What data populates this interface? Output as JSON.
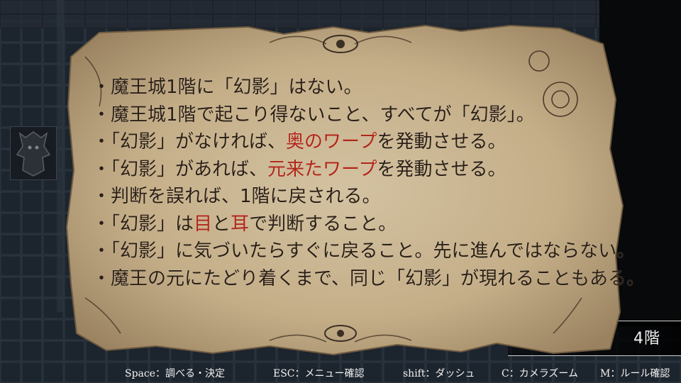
{
  "rules": [
    {
      "segments": [
        {
          "text": "・魔王城1階に「幻影」はない。",
          "hl": false
        }
      ]
    },
    {
      "segments": [
        {
          "text": "・魔王城1階で起こり得ないこと、すべてが「幻影」。",
          "hl": false
        }
      ]
    },
    {
      "segments": [
        {
          "text": "・「幻影」がなければ、",
          "hl": false
        },
        {
          "text": "奥のワープ",
          "hl": true
        },
        {
          "text": "を発動させる。",
          "hl": false
        }
      ]
    },
    {
      "segments": [
        {
          "text": "・「幻影」があれば、",
          "hl": false
        },
        {
          "text": "元来たワープ",
          "hl": true
        },
        {
          "text": "を発動させる。",
          "hl": false
        }
      ]
    },
    {
      "segments": [
        {
          "text": "・判断を誤れば、1階に戻される。",
          "hl": false
        }
      ]
    },
    {
      "segments": [
        {
          "text": "・「幻影」は",
          "hl": false
        },
        {
          "text": "目",
          "hl": true
        },
        {
          "text": "と",
          "hl": false
        },
        {
          "text": "耳",
          "hl": true
        },
        {
          "text": "で判断すること。",
          "hl": false
        }
      ]
    },
    {
      "segments": [
        {
          "text": "・「幻影」に気づいたらすぐに戻ること。先に進んではならない。",
          "hl": false
        }
      ]
    },
    {
      "segments": [
        {
          "text": "・魔王の元にたどり着くまで、同じ「幻影」が現れることもある。",
          "hl": false
        }
      ]
    }
  ],
  "location": {
    "label": "王城　 4階"
  },
  "controls": [
    {
      "label": "Space：調べる・決定"
    },
    {
      "label": "ESC：メニュー確認"
    },
    {
      "label": "shift：ダッシュ"
    },
    {
      "label": "C：カメラズーム"
    },
    {
      "label": "M：ルール確認"
    }
  ],
  "colors": {
    "ink": "#2a1f17",
    "highlight": "#b1251a",
    "parchment": "#c9b48f",
    "floor": "#1e2630"
  },
  "icons": [
    "gargoyle-statue-icon",
    "eye-ornament-icon",
    "gear-ornament-icon"
  ]
}
